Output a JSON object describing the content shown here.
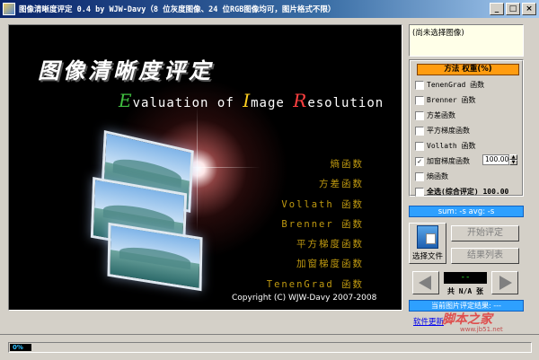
{
  "window": {
    "title": "图像清晰度评定 0.4 by WJW-Davy（8 位灰度图像、24 位RGB图像均可，图片格式不限）",
    "minimize": "_",
    "maximize": "□",
    "close": "×"
  },
  "splash": {
    "cn_title": "图像清晰度评定",
    "en_title": {
      "e_letter": "E",
      "e_rest": "valuation of ",
      "i_letter": "I",
      "i_rest": "mage ",
      "r_letter": "R",
      "r_rest": "esolution"
    },
    "functions": [
      "熵函数",
      "方差函数",
      "Vollath 函数",
      "Brenner 函数",
      "平方梯度函数",
      "加窗梯度函数",
      "TenenGrad 函数"
    ],
    "copyright": "Copyright (C) WJW-Davy 2007-2008"
  },
  "preview": {
    "text": "(尚未选择图像)"
  },
  "methods": {
    "header": "方法   权重(%)",
    "options": [
      {
        "label": "TenenGrad 函数",
        "checked": false
      },
      {
        "label": "Brenner 函数",
        "checked": false
      },
      {
        "label": "方差函数",
        "checked": false
      },
      {
        "label": "平方梯度函数",
        "checked": false
      },
      {
        "label": "Vollath 函数",
        "checked": false
      },
      {
        "label": "加窗梯度函数",
        "checked": true
      },
      {
        "label": "熵函数",
        "checked": false
      }
    ],
    "weight_value": "100.00",
    "select_all": "全选(综合评定)  100.00",
    "check_mark": "✓"
  },
  "summary": {
    "text": "sum: -s avg: -s"
  },
  "controls": {
    "select_file": "选择文件",
    "start": "开始评定",
    "results": "结果列表",
    "lcd": "--",
    "count": "共 N/A 张",
    "current_result": "当前图片评定结果: ---"
  },
  "footer": {
    "update_link": "软件更新",
    "watermark": "脚本之家",
    "watermark_url": "www.jb51.net",
    "progress": "0%"
  },
  "colors": {
    "title_gradient_start": "#0a246a",
    "method_header": "#ff9c10",
    "info_bar": "#2ea0ff",
    "function_text": "#c09a10"
  }
}
